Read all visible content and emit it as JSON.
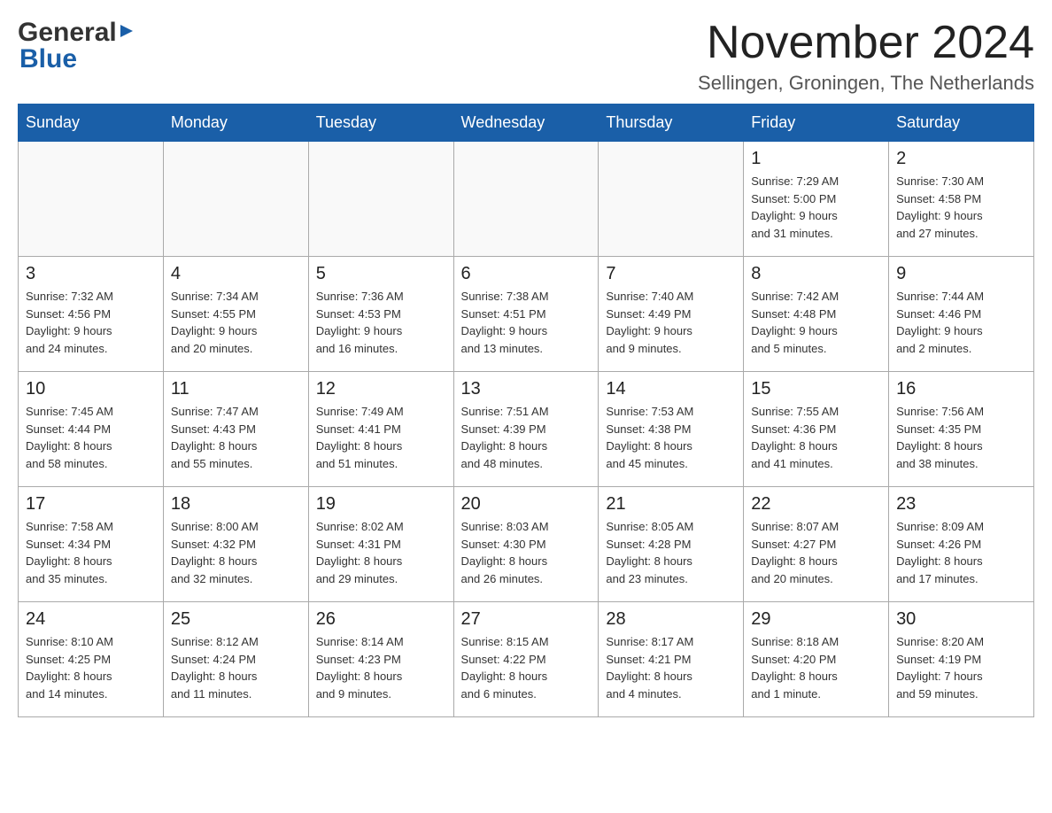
{
  "header": {
    "logo_general": "General",
    "logo_blue": "Blue",
    "month_title": "November 2024",
    "location": "Sellingen, Groningen, The Netherlands"
  },
  "days_of_week": [
    "Sunday",
    "Monday",
    "Tuesday",
    "Wednesday",
    "Thursday",
    "Friday",
    "Saturday"
  ],
  "weeks": [
    [
      {
        "day": "",
        "info": ""
      },
      {
        "day": "",
        "info": ""
      },
      {
        "day": "",
        "info": ""
      },
      {
        "day": "",
        "info": ""
      },
      {
        "day": "",
        "info": ""
      },
      {
        "day": "1",
        "info": "Sunrise: 7:29 AM\nSunset: 5:00 PM\nDaylight: 9 hours\nand 31 minutes."
      },
      {
        "day": "2",
        "info": "Sunrise: 7:30 AM\nSunset: 4:58 PM\nDaylight: 9 hours\nand 27 minutes."
      }
    ],
    [
      {
        "day": "3",
        "info": "Sunrise: 7:32 AM\nSunset: 4:56 PM\nDaylight: 9 hours\nand 24 minutes."
      },
      {
        "day": "4",
        "info": "Sunrise: 7:34 AM\nSunset: 4:55 PM\nDaylight: 9 hours\nand 20 minutes."
      },
      {
        "day": "5",
        "info": "Sunrise: 7:36 AM\nSunset: 4:53 PM\nDaylight: 9 hours\nand 16 minutes."
      },
      {
        "day": "6",
        "info": "Sunrise: 7:38 AM\nSunset: 4:51 PM\nDaylight: 9 hours\nand 13 minutes."
      },
      {
        "day": "7",
        "info": "Sunrise: 7:40 AM\nSunset: 4:49 PM\nDaylight: 9 hours\nand 9 minutes."
      },
      {
        "day": "8",
        "info": "Sunrise: 7:42 AM\nSunset: 4:48 PM\nDaylight: 9 hours\nand 5 minutes."
      },
      {
        "day": "9",
        "info": "Sunrise: 7:44 AM\nSunset: 4:46 PM\nDaylight: 9 hours\nand 2 minutes."
      }
    ],
    [
      {
        "day": "10",
        "info": "Sunrise: 7:45 AM\nSunset: 4:44 PM\nDaylight: 8 hours\nand 58 minutes."
      },
      {
        "day": "11",
        "info": "Sunrise: 7:47 AM\nSunset: 4:43 PM\nDaylight: 8 hours\nand 55 minutes."
      },
      {
        "day": "12",
        "info": "Sunrise: 7:49 AM\nSunset: 4:41 PM\nDaylight: 8 hours\nand 51 minutes."
      },
      {
        "day": "13",
        "info": "Sunrise: 7:51 AM\nSunset: 4:39 PM\nDaylight: 8 hours\nand 48 minutes."
      },
      {
        "day": "14",
        "info": "Sunrise: 7:53 AM\nSunset: 4:38 PM\nDaylight: 8 hours\nand 45 minutes."
      },
      {
        "day": "15",
        "info": "Sunrise: 7:55 AM\nSunset: 4:36 PM\nDaylight: 8 hours\nand 41 minutes."
      },
      {
        "day": "16",
        "info": "Sunrise: 7:56 AM\nSunset: 4:35 PM\nDaylight: 8 hours\nand 38 minutes."
      }
    ],
    [
      {
        "day": "17",
        "info": "Sunrise: 7:58 AM\nSunset: 4:34 PM\nDaylight: 8 hours\nand 35 minutes."
      },
      {
        "day": "18",
        "info": "Sunrise: 8:00 AM\nSunset: 4:32 PM\nDaylight: 8 hours\nand 32 minutes."
      },
      {
        "day": "19",
        "info": "Sunrise: 8:02 AM\nSunset: 4:31 PM\nDaylight: 8 hours\nand 29 minutes."
      },
      {
        "day": "20",
        "info": "Sunrise: 8:03 AM\nSunset: 4:30 PM\nDaylight: 8 hours\nand 26 minutes."
      },
      {
        "day": "21",
        "info": "Sunrise: 8:05 AM\nSunset: 4:28 PM\nDaylight: 8 hours\nand 23 minutes."
      },
      {
        "day": "22",
        "info": "Sunrise: 8:07 AM\nSunset: 4:27 PM\nDaylight: 8 hours\nand 20 minutes."
      },
      {
        "day": "23",
        "info": "Sunrise: 8:09 AM\nSunset: 4:26 PM\nDaylight: 8 hours\nand 17 minutes."
      }
    ],
    [
      {
        "day": "24",
        "info": "Sunrise: 8:10 AM\nSunset: 4:25 PM\nDaylight: 8 hours\nand 14 minutes."
      },
      {
        "day": "25",
        "info": "Sunrise: 8:12 AM\nSunset: 4:24 PM\nDaylight: 8 hours\nand 11 minutes."
      },
      {
        "day": "26",
        "info": "Sunrise: 8:14 AM\nSunset: 4:23 PM\nDaylight: 8 hours\nand 9 minutes."
      },
      {
        "day": "27",
        "info": "Sunrise: 8:15 AM\nSunset: 4:22 PM\nDaylight: 8 hours\nand 6 minutes."
      },
      {
        "day": "28",
        "info": "Sunrise: 8:17 AM\nSunset: 4:21 PM\nDaylight: 8 hours\nand 4 minutes."
      },
      {
        "day": "29",
        "info": "Sunrise: 8:18 AM\nSunset: 4:20 PM\nDaylight: 8 hours\nand 1 minute."
      },
      {
        "day": "30",
        "info": "Sunrise: 8:20 AM\nSunset: 4:19 PM\nDaylight: 7 hours\nand 59 minutes."
      }
    ]
  ]
}
